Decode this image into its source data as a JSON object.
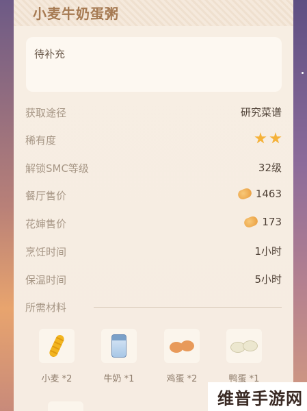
{
  "recipe": {
    "title": "小麦牛奶蛋粥",
    "description": "待补充"
  },
  "stats": [
    {
      "label": "获取途径",
      "value": "研究菜谱"
    },
    {
      "label": "稀有度",
      "value": "",
      "stars": 2
    },
    {
      "label": "解锁SMC等级",
      "value": "32级"
    },
    {
      "label": "餐厅售价",
      "value": "1463",
      "icon": "coin-icon"
    },
    {
      "label": "花婶售价",
      "value": "173",
      "icon": "coin-icon"
    },
    {
      "label": "烹饪时间",
      "value": "1小时"
    },
    {
      "label": "保温时间",
      "value": "5小时"
    }
  ],
  "materials": {
    "label": "所需材料",
    "items": [
      {
        "name": "小麦 *2",
        "icon": "wheat-icon"
      },
      {
        "name": "牛奶 *1",
        "icon": "milk-bottle-icon"
      },
      {
        "name": "鸡蛋 *2",
        "icon": "chicken-egg-icon"
      },
      {
        "name": "鸭蛋 *1",
        "icon": "duck-egg-icon"
      }
    ]
  },
  "watermark": "维普手游网",
  "colors": {
    "title": "#a67a52",
    "label": "#a79786",
    "value": "#4e4035",
    "star": "#f5b23a"
  }
}
